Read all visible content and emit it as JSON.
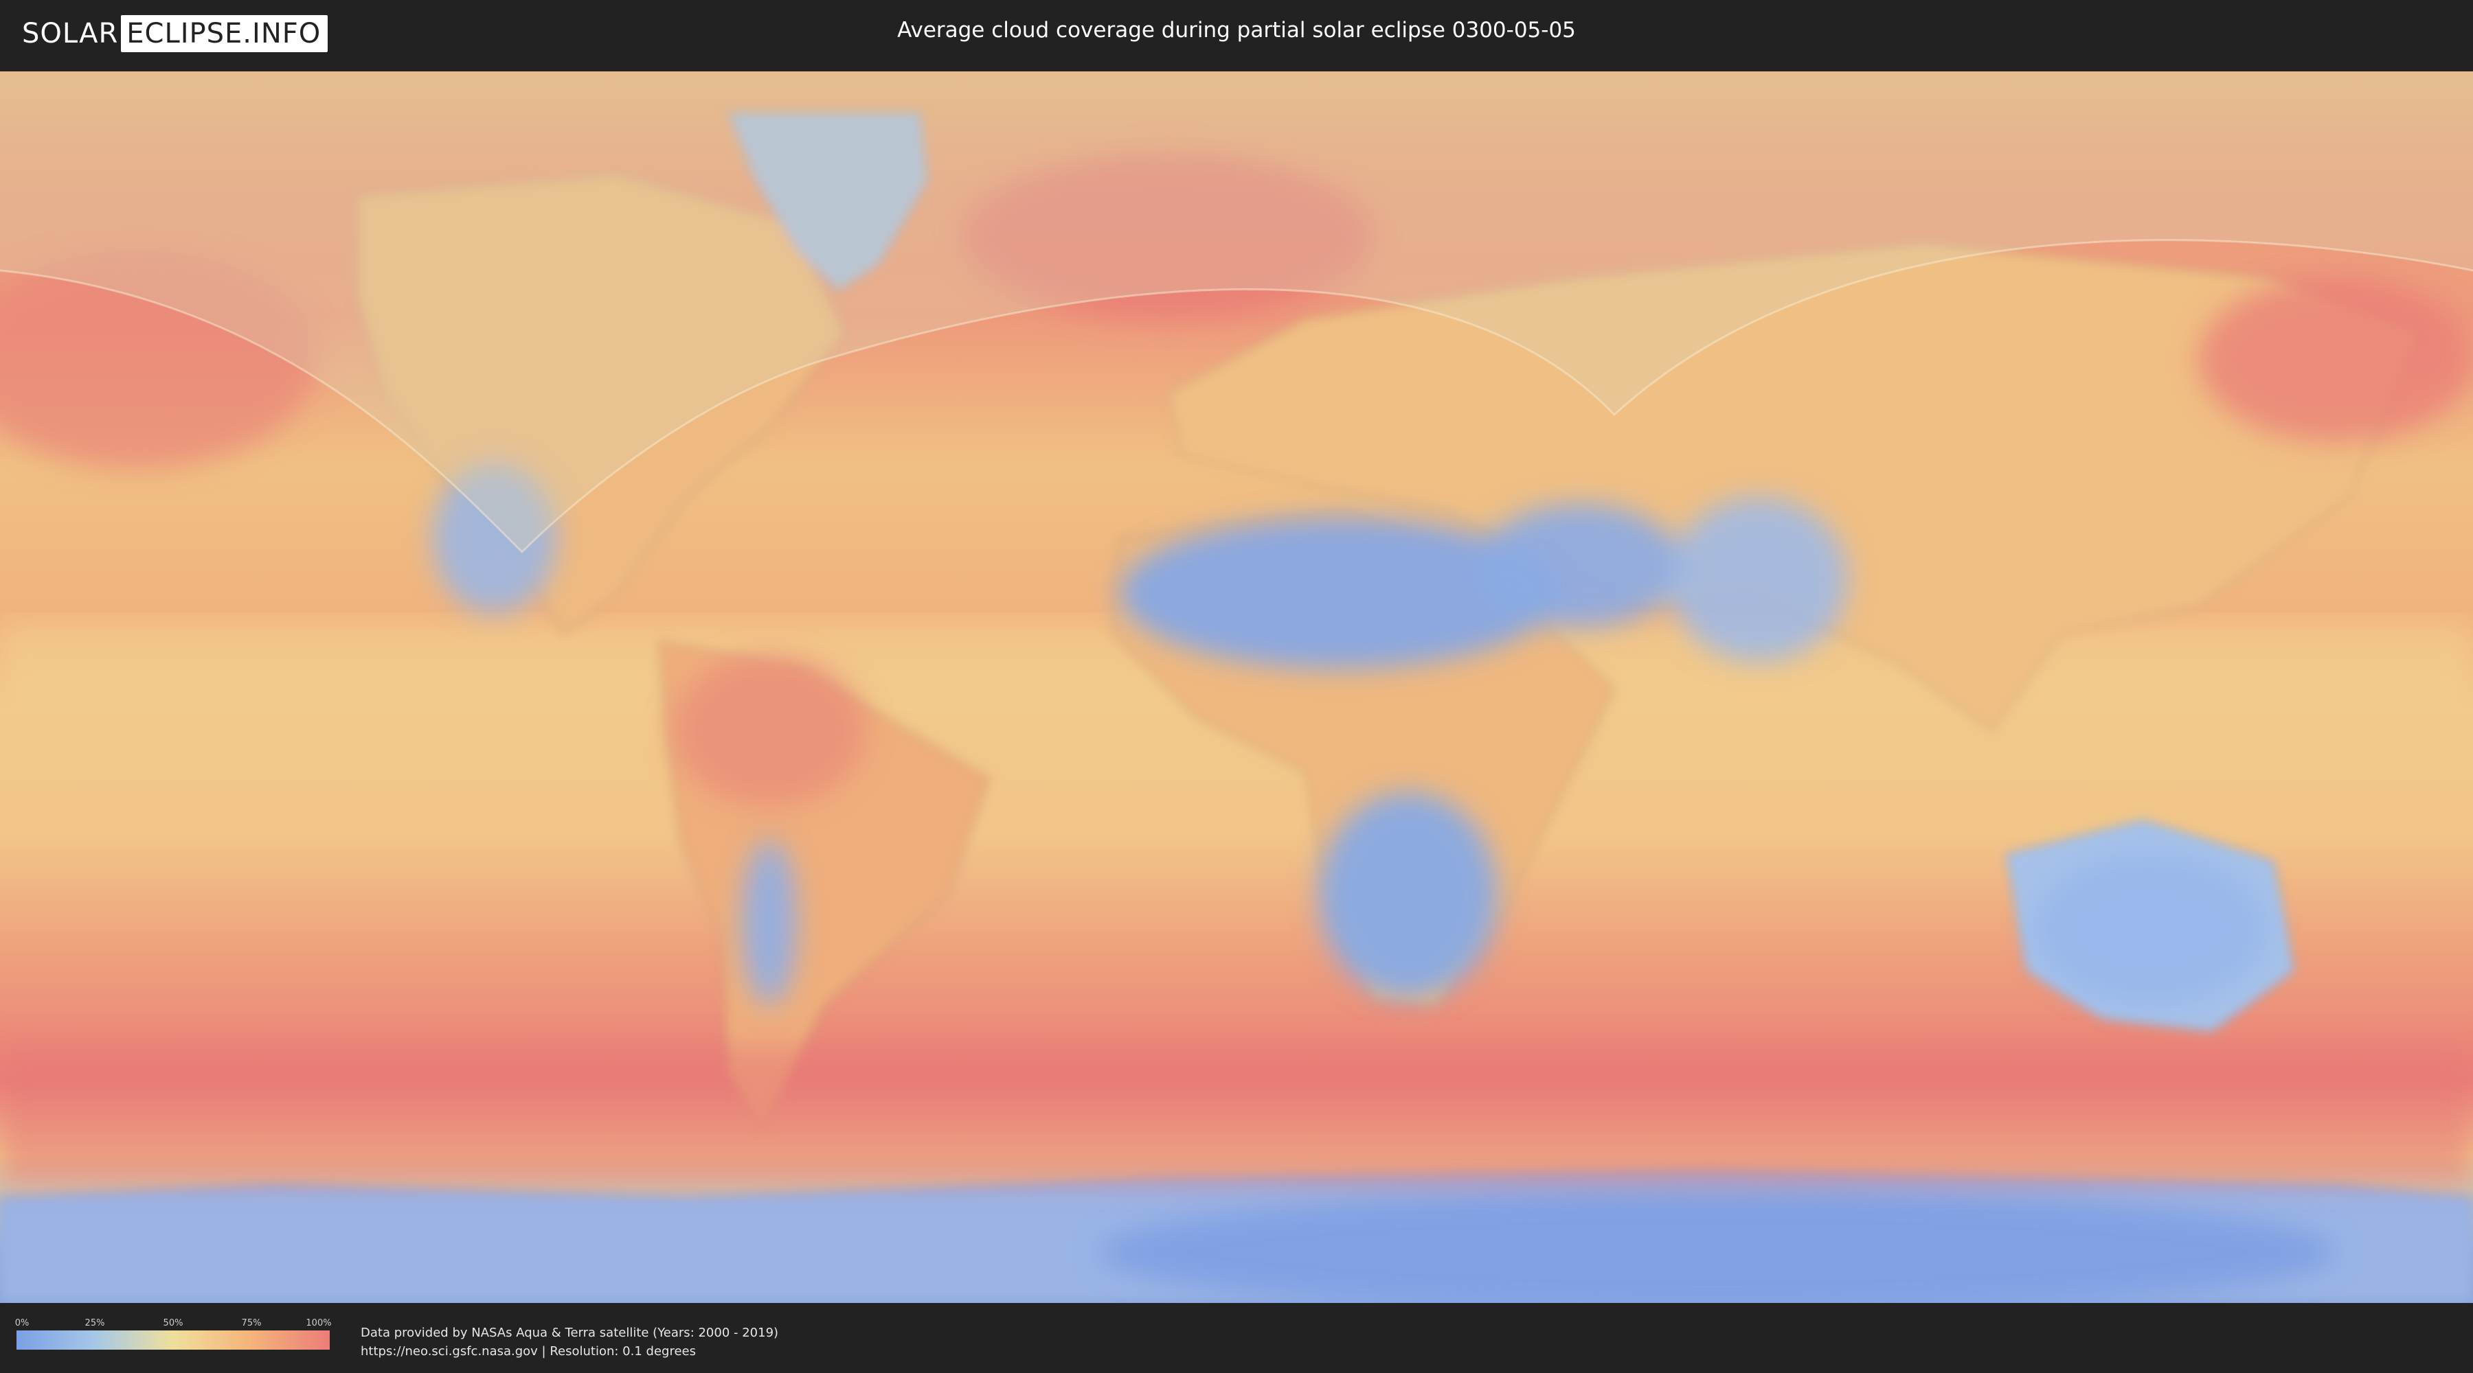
{
  "logo": {
    "part1": "SOLAR",
    "part2": "ECLIPSE.INFO"
  },
  "title": "Average cloud coverage during partial solar eclipse 0300-05-05",
  "legend": {
    "ticks": [
      "0%",
      "25%",
      "50%",
      "75%",
      "100%"
    ],
    "colors": [
      "#7aa0e6",
      "#a6c7e8",
      "#f0df9c",
      "#f4b37a",
      "#ec7d79"
    ]
  },
  "credits": {
    "line1": "Data provided by NASAs Aqua & Terra satellite (Years: 2000 - 2019)",
    "line2": "https://neo.sci.gsfc.nasa.gov | Resolution: 0.1 degrees"
  },
  "map": {
    "eclipse_overlay": "partial eclipse visibility zone (northern hemisphere, shaded)"
  }
}
